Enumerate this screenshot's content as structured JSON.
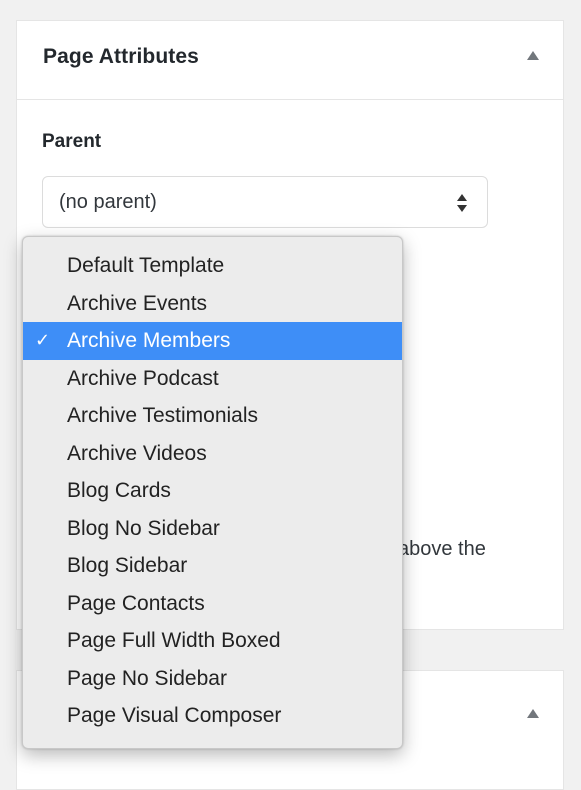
{
  "page_attributes": {
    "title": "Page Attributes",
    "parent_label": "Parent",
    "parent_select": {
      "selected": "(no parent)"
    },
    "obscured_text_fragment": "above the"
  },
  "template_dropdown": {
    "selected": "Archive Members",
    "options": [
      "Default Template",
      "Archive Events",
      "Archive Members",
      "Archive Podcast",
      "Archive Testimonials",
      "Archive Videos",
      "Blog Cards",
      "Blog No Sidebar",
      "Blog Sidebar",
      "Page Contacts",
      "Page Full Width Boxed",
      "Page No Sidebar",
      "Page Visual Composer"
    ],
    "check_glyph": "✓"
  },
  "icons": {
    "panel_toggle": "triangle-up-icon",
    "select_stepper": "up-down-chevron-icon",
    "selected_check": "checkmark-icon"
  },
  "colors": {
    "selection_highlight": "#3e8ef7",
    "panel_background": "#ffffff",
    "page_background": "#f1f1f1",
    "dropdown_background": "#ececec"
  }
}
